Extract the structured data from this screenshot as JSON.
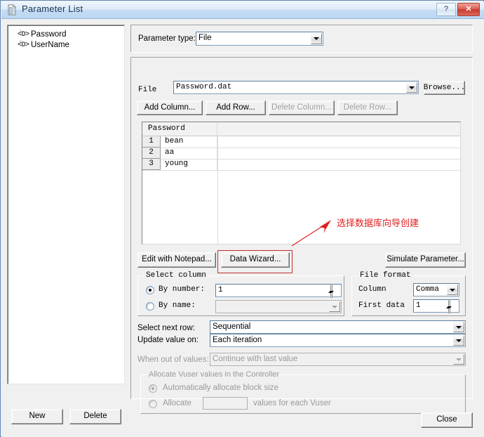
{
  "window": {
    "title": "Parameter List",
    "icon": "parameter-list-icon",
    "help_label": "?",
    "close_label": "✕"
  },
  "tree": {
    "items": [
      {
        "glyph": "<D>",
        "label": "Password"
      },
      {
        "glyph": "<D>",
        "label": "UserName"
      }
    ]
  },
  "parameter_type": {
    "label": "Parameter type:",
    "value": "File"
  },
  "file_row": {
    "label": "File",
    "value": "Password.dat",
    "browse_label": "Browse..."
  },
  "table_buttons": {
    "add_column": "Add Column...",
    "add_row": "Add Row...",
    "delete_column": "Delete Column...",
    "delete_row": "Delete Row..."
  },
  "grid": {
    "columns": [
      "Password"
    ],
    "rows": [
      {
        "num": "1",
        "values": [
          "bean"
        ]
      },
      {
        "num": "2",
        "values": [
          "aa"
        ]
      },
      {
        "num": "3",
        "values": [
          "young"
        ]
      }
    ]
  },
  "annotation": {
    "text": "选择数据库向导创建",
    "color": "#e02020"
  },
  "action_buttons": {
    "edit_notepad": "Edit with Notepad...",
    "data_wizard": "Data Wizard...",
    "simulate_parameter": "Simulate Parameter..."
  },
  "select_column": {
    "title": "Select column",
    "by_number_label": "By number:",
    "by_number_value": "1",
    "by_number_selected": true,
    "by_name_label": "By name:",
    "by_name_value": "",
    "by_name_selected": false
  },
  "file_format": {
    "title": "File format",
    "column_label": "Column",
    "column_value": "Comma",
    "first_data_label": "First data",
    "first_data_value": "1"
  },
  "row_options": {
    "select_next_row_label": "Select next row:",
    "select_next_row_value": "Sequential",
    "update_value_on_label": "Update value on:",
    "update_value_on_value": "Each iteration",
    "when_out_of_values_label": "When out of values:",
    "when_out_of_values_value": "Continue with last value"
  },
  "allocate": {
    "title": "Allocate Vuser values in the Controller",
    "auto_label": "Automatically allocate block size",
    "auto_selected": true,
    "allocate_label": "Allocate",
    "allocate_value": "",
    "allocate_suffix": "values for each Vuser"
  },
  "bottom_buttons": {
    "new_label": "New",
    "delete_label": "Delete",
    "close_label": "Close"
  }
}
